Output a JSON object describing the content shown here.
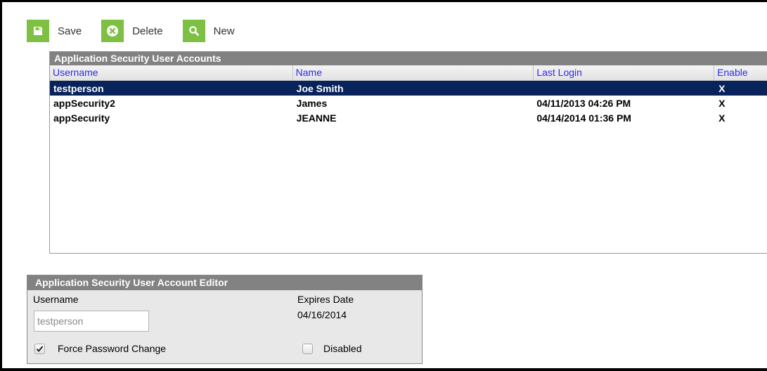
{
  "toolbar": {
    "save_label": "Save",
    "delete_label": "Delete",
    "new_label": "New"
  },
  "grid": {
    "title": "Application Security User Accounts",
    "columns": [
      "Username",
      "Name",
      "Last Login",
      "Enable"
    ],
    "rows": [
      {
        "username": "testperson",
        "name": "Joe Smith",
        "last_login": "",
        "enabled": "X",
        "selected": true
      },
      {
        "username": "appSecurity2",
        "name": "James",
        "last_login": "04/11/2013 04:26 PM",
        "enabled": "X",
        "selected": false
      },
      {
        "username": "appSecurity",
        "name": "JEANNE",
        "last_login": "04/14/2014 01:36 PM",
        "enabled": "X",
        "selected": false
      }
    ]
  },
  "editor": {
    "title": "Application Security User Account Editor",
    "username_label": "Username",
    "username_value": "testperson",
    "expires_label": "Expires Date",
    "expires_value": "04/16/2014",
    "force_password_label": "Force Password Change",
    "force_password_checked": true,
    "disabled_label": "Disabled",
    "disabled_checked": false
  },
  "colors": {
    "toolbar_icon_bg": "#7dc043",
    "panel_title_bg": "#828282",
    "selected_row_bg": "#08235a",
    "header_link": "#2a2aee"
  },
  "icons": {
    "save": "save-icon",
    "delete": "delete-icon",
    "new": "search-icon"
  }
}
